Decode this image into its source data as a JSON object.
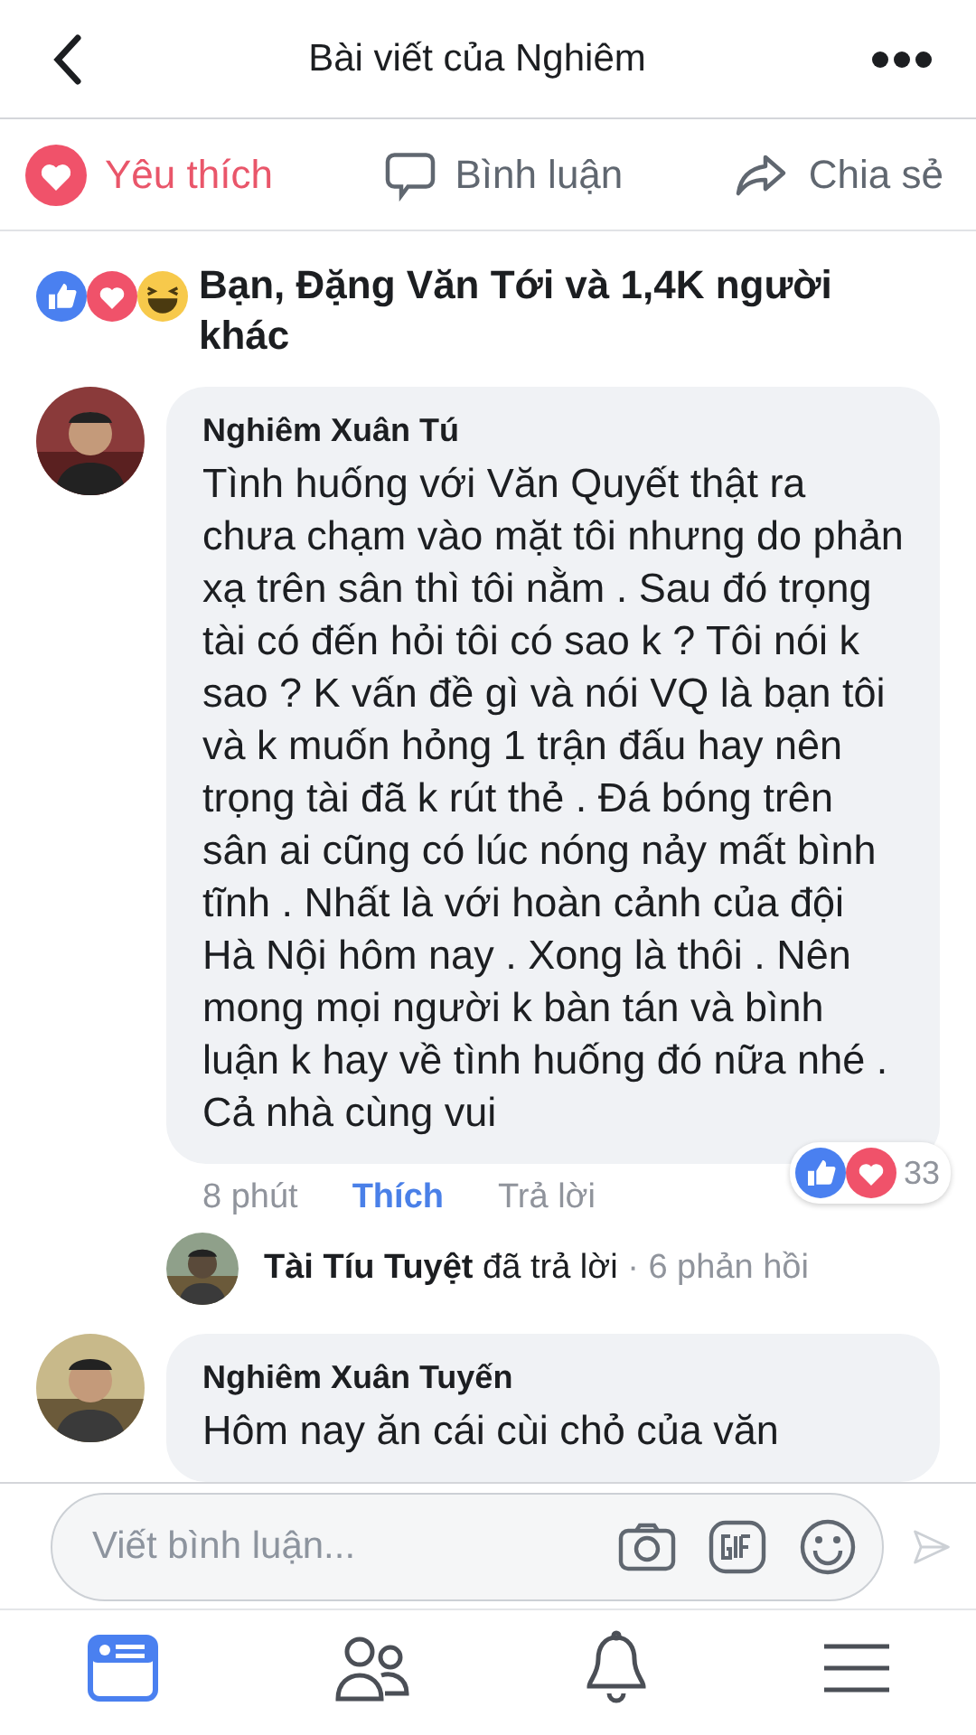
{
  "header": {
    "title": "Bài viết của Nghiêm"
  },
  "actions": [
    {
      "kind": "love",
      "label": "Yêu thích",
      "selected": true
    },
    {
      "kind": "comment",
      "label": "Bình luận",
      "selected": false
    },
    {
      "kind": "share",
      "label": "Chia sẻ",
      "selected": false
    }
  ],
  "reactions_summary": {
    "text": "Bạn, Đặng Văn Tới và 1,4K người khác"
  },
  "comments": [
    {
      "author": "Nghiêm Xuân Tú",
      "text": "Tình huống với Văn Quyết thật ra chưa chạm vào mặt tôi nhưng do phản xạ trên sân thì tôi nằm . Sau đó trọng tài có đến hỏi tôi có sao k ? Tôi nói k sao ? K vấn đề gì và nói VQ là bạn tôi và k muốn hỏng 1 trận đấu hay nên trọng tài đã k rút thẻ . Đá bóng trên sân ai cũng có lúc nóng nảy mất bình tĩnh . Nhất là với hoàn cảnh của đội Hà Nội hôm nay . Xong là thôi . Nên mong mọi người k bàn tán và bình luận k hay về tình huống đó nữa nhé . Cả nhà cùng vui",
      "time": "8 phút",
      "like_label": "Thích",
      "liked": true,
      "reply_label": "Trả lời",
      "reaction_count": "33",
      "reply_summary": {
        "author": "Tài Tíu Tuyệt",
        "action": "đã trả lời",
        "count": "· 6 phản hồi"
      }
    },
    {
      "author": "Nghiêm Xuân Tuyến",
      "text": "Hôm nay ăn cái cùi chỏ của văn"
    }
  ],
  "composer": {
    "placeholder": "Viết bình luận..."
  },
  "tab_bar": [
    {
      "kind": "feed",
      "selected": true
    },
    {
      "kind": "friends",
      "selected": false
    },
    {
      "kind": "notifications",
      "selected": false
    },
    {
      "kind": "menu",
      "selected": false
    }
  ]
}
